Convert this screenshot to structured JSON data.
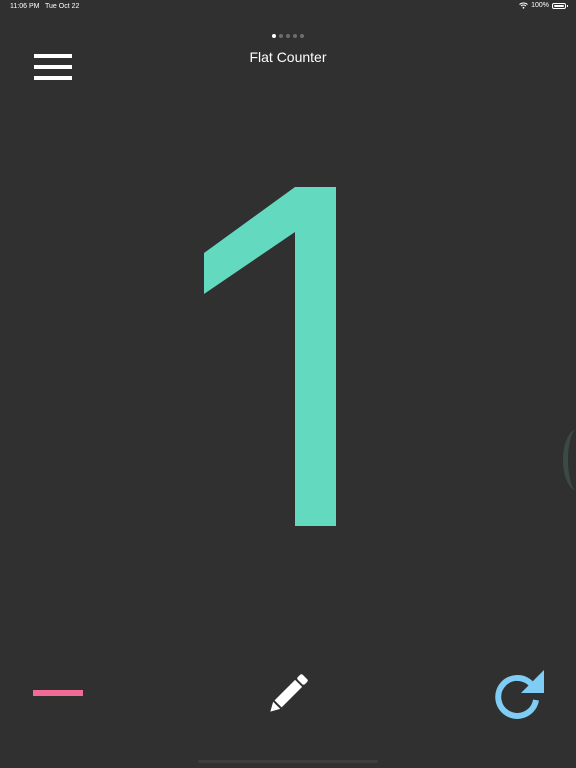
{
  "status_bar": {
    "time": "11:06 PM",
    "date": "Tue Oct 22",
    "battery": "100%",
    "battery_level": 1.0
  },
  "pager": {
    "page_count": 5,
    "active_index": 0
  },
  "header": {
    "title": "Flat Counter"
  },
  "counter": {
    "value": "1",
    "color": "#63d9bf"
  },
  "icons": {
    "menu": "menu-icon",
    "minus": "minus-icon",
    "edit": "pencil-icon",
    "reset": "refresh-icon"
  },
  "colors": {
    "background": "#303030",
    "minus": "#f06b95",
    "reset": "#7fcdf4",
    "foreground": "#ffffff"
  }
}
